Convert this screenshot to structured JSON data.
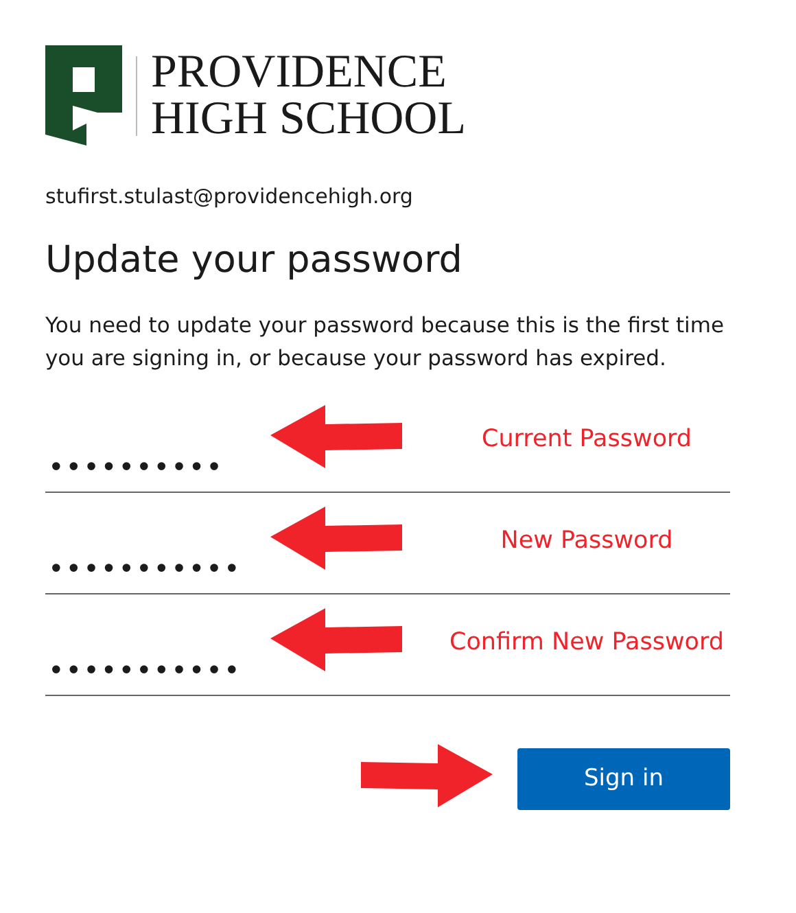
{
  "logo": {
    "line_1": "PROVIDENCE",
    "line_2": "HIGH SCHOOL"
  },
  "account": "stufirst.stulast@providencehigh.org",
  "title": "Update your password",
  "description": "You need to update your password because this is the first time you are signing in, or because your password has expired.",
  "fields": [
    {
      "value": "••••••••••",
      "annotation": "Current Password"
    },
    {
      "value": "•••••••••••",
      "annotation": "New Password"
    },
    {
      "value": "•••••••••••",
      "annotation": "Confirm New Password"
    }
  ],
  "submit": {
    "label": "Sign in"
  }
}
